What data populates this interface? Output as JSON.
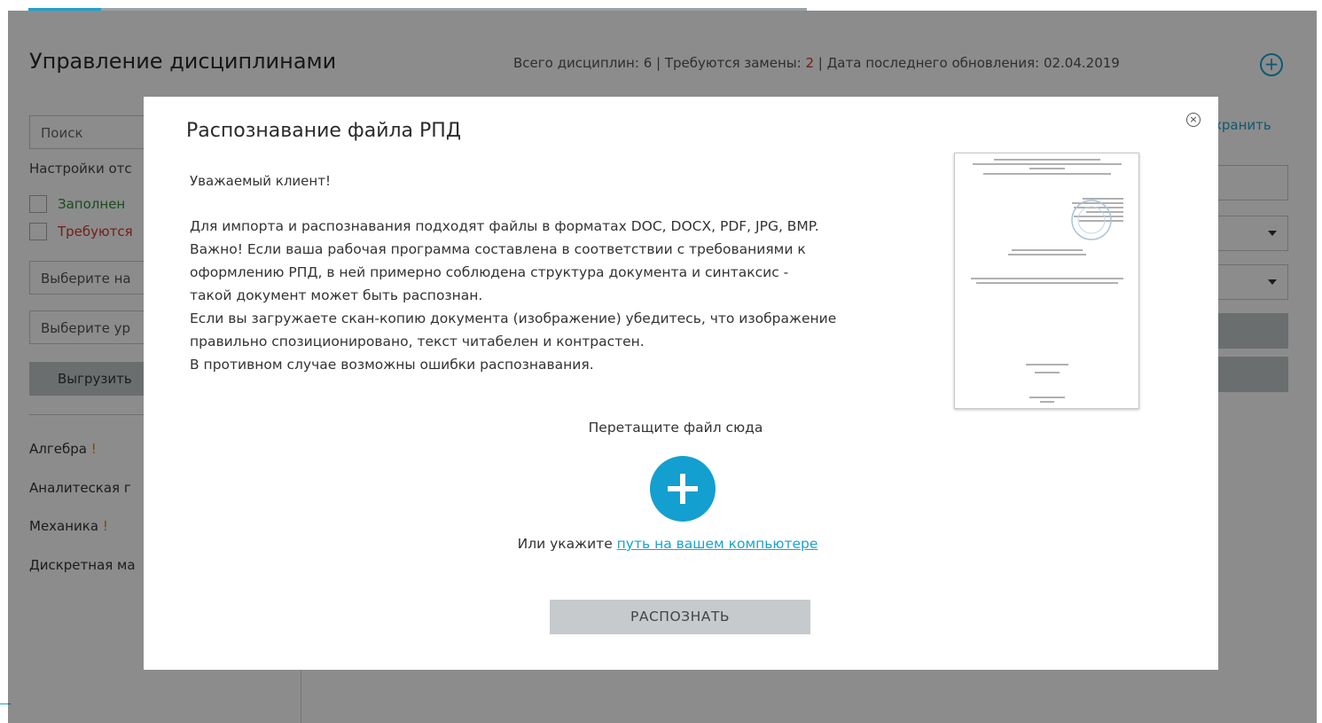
{
  "app": {
    "page_title": "Управление дисциплинами",
    "stats": {
      "total_label": "Всего дисциплин: 6 | Требуются замены: ",
      "replacements": "2",
      "updated_label": " | Дата последнего обновления: 02.04.2019"
    },
    "add_icon": "+",
    "search_placeholder": "Поиск",
    "filters_title": "Настройки отс",
    "filter_filled": "Заполнен",
    "filter_required": "Требуются",
    "select_direction": "Выберите на",
    "select_level": "Выберите ур",
    "export_button": "Выгрузить",
    "disciplines": [
      {
        "name": "Алгебра",
        "mark": "!"
      },
      {
        "name": "Аналитеская г",
        "mark": ""
      },
      {
        "name": "Механика",
        "mark": "!"
      },
      {
        "name": "Дискретная ма",
        "mark": ""
      }
    ],
    "save_link": "хранить"
  },
  "modal": {
    "title": "Распознавание файла РПД",
    "close_icon": "×",
    "greeting": "Уважаемый клиент!",
    "body_lines": [
      "Для импорта и распознавания подходят файлы в форматах DOC, DOCX, PDF, JPG, BMP.",
      "Важно! Если ваша рабочая программа составлена в соответствии с требованиями к",
      "оформлению РПД, в ней примерно соблюдена структура документа и синтаксис -",
      "такой документ может быть распознан.",
      "Если вы загружаете скан-копию документа (изображение) убедитесь, что изображение",
      "правильно спозиционировано, текст читабелен и контрастен.",
      "В противном случае возможны ошибки распознавания."
    ],
    "drag_text": "Перетащите файл сюда",
    "upload_icon": "plus-icon",
    "path_prefix": "Или укажите ",
    "path_link": "путь на вашем компьютере",
    "recognize_button": "РАСПОЗНАТЬ"
  },
  "colors": {
    "accent": "#1aa3cf",
    "upload_button": "#139fd0",
    "warning": "#d0392b",
    "mark": "#e08a00"
  }
}
